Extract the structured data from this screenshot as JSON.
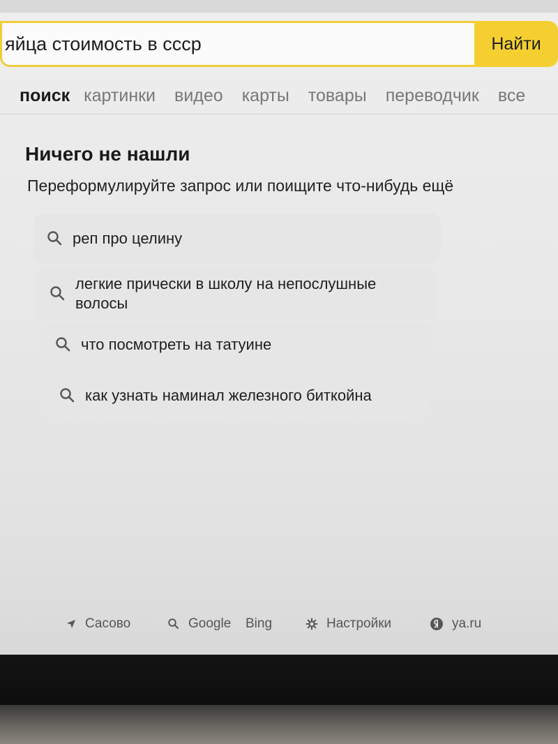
{
  "search": {
    "query": "яйца стоимость в ссср",
    "button_label": "Найти"
  },
  "tabs": [
    {
      "label": "поиск",
      "active": true
    },
    {
      "label": "картинки",
      "active": false
    },
    {
      "label": "видео",
      "active": false
    },
    {
      "label": "карты",
      "active": false
    },
    {
      "label": "товары",
      "active": false
    },
    {
      "label": "переводчик",
      "active": false
    },
    {
      "label": "все",
      "active": false
    }
  ],
  "results": {
    "headline": "Ничего не нашли",
    "subline": "Переформулируйте запрос или поищите что-нибудь ещё"
  },
  "suggestions": [
    {
      "text": "реп про целину",
      "icon": "search-icon"
    },
    {
      "text": "легкие прически в школу на непослушные волосы",
      "icon": "search-icon"
    },
    {
      "text": "что посмотреть на татуине",
      "icon": "search-icon"
    },
    {
      "text": "как узнать наминал железного биткойна",
      "icon": "search-icon"
    }
  ],
  "footer": {
    "location": "Сасово",
    "google": "Google",
    "bing": "Bing",
    "settings": "Настройки",
    "ya": "ya.ru"
  },
  "colors": {
    "accent": "#f5cf30",
    "background": "#ececec",
    "suggestion_bg": "#e6e6e6"
  }
}
